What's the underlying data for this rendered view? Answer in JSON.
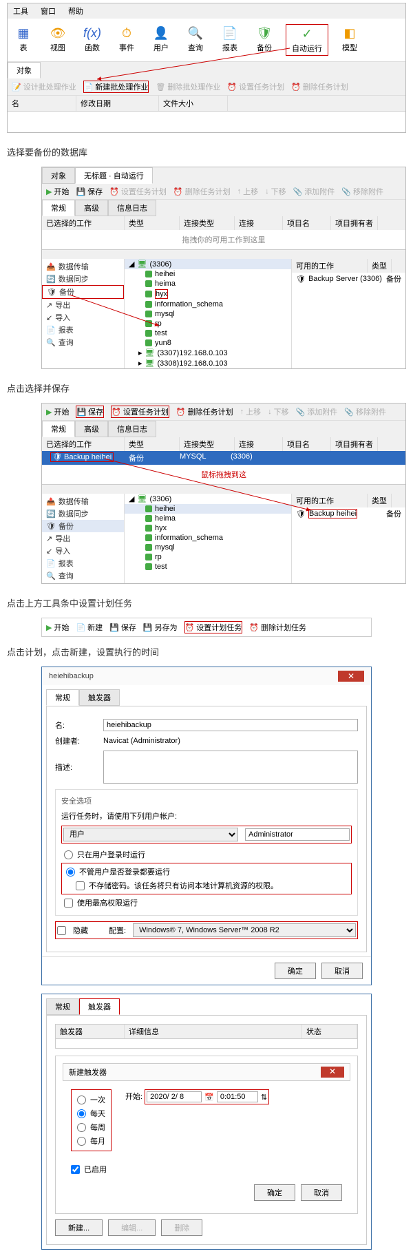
{
  "menu": {
    "tools": "工具",
    "window": "窗口",
    "help": "帮助"
  },
  "ribbon": {
    "table": "表",
    "view": "视图",
    "fx": "函数",
    "event": "事件",
    "user": "用户",
    "query": "查询",
    "report": "报表",
    "backup": "备份",
    "auto": "自动运行",
    "model": "模型"
  },
  "tabObject": "对象",
  "batchBar": {
    "design": "设计批处理作业",
    "new": "新建批处理作业",
    "delete": "删除批处理作业",
    "setPlan": "设置任务计划",
    "delPlan": "删除任务计划"
  },
  "cols1": {
    "name": "名",
    "modDate": "修改日期",
    "fileSize": "文件大小"
  },
  "step1": "选择要备份的数据库",
  "tabUntitled": "无标题 · 自动运行",
  "autoBar": {
    "start": "开始",
    "save": "保存",
    "setTask": "设置任务计划",
    "delTask": "删除任务计划",
    "up": "上移",
    "down": "下移",
    "addAttach": "添加附件",
    "delAttach": "移除附件"
  },
  "subTabs": {
    "general": "常规",
    "advanced": "高级",
    "log": "信息日志"
  },
  "workCols": {
    "selected": "已选择的工作",
    "type": "类型",
    "connType": "连接类型",
    "conn": "连接",
    "project": "项目名",
    "owner": "项目拥有者"
  },
  "dragHint": "拖拽你的可用工作到这里",
  "leftActions": {
    "transfer": "数据传输",
    "sync": "数据同步",
    "backup": "备份",
    "export": "导出",
    "import": "导入",
    "report": "报表",
    "query": "查询"
  },
  "dbRoot": "(3306)",
  "dbs": [
    "heihei",
    "heima",
    "hyx",
    "information_schema",
    "mysql",
    "rp",
    "test",
    "yun8"
  ],
  "dbExtra": [
    "(3307)192.168.0.103",
    "(3308)192.168.0.103"
  ],
  "availableCols": {
    "work": "可用的工作",
    "type": "类型"
  },
  "backupServer": "Backup Server (3306)",
  "backupType": "备份",
  "step2": "点击选择并保存",
  "selectedRow": {
    "name": "Backup heihei",
    "type": "备份",
    "connType": "MYSQL",
    "conn": "(3306)"
  },
  "dragMouseHint": "鼠标拖拽到这",
  "backupHeihei": "Backup heihei",
  "step3": "点击上方工具条中设置计划任务",
  "miniBar": {
    "start": "开始",
    "new": "新建",
    "save": "保存",
    "saveAs": "另存为",
    "setPlan": "设置计划任务",
    "delPlan": "删除计划任务"
  },
  "step4": "点击计划，点击新建，设置执行的时间",
  "dialog": {
    "title": "heiehibackup",
    "tabGeneral": "常规",
    "tabTrigger": "触发器",
    "nameLabel": "名:",
    "nameValue": "heiehibackup",
    "creatorLabel": "创建者:",
    "creatorValue": "Navicat (Administrator)",
    "descLabel": "描述:",
    "secTitle": "安全选项",
    "runAsLabel": "运行任务时，请使用下列用户帐户:",
    "userLabel": "用户",
    "userValue": "Administrator",
    "opt1": "只在用户登录时运行",
    "opt2": "不管用户是否登录都要运行",
    "opt2sub": "不存储密码。该任务将只有访问本地计算机资源的权限。",
    "opt3": "使用最高权限运行",
    "hidden": "隐藏",
    "configLabel": "配置:",
    "configValue": "Windows® 7, Windows Server™ 2008 R2",
    "ok": "确定",
    "cancel": "取消"
  },
  "trigger": {
    "tabGeneral": "常规",
    "tabTrigger": "触发器",
    "colTrigger": "触发器",
    "colDetail": "详细信息",
    "colStatus": "状态",
    "newTrigger": "新建触发器",
    "once": "一次",
    "daily": "每天",
    "weekly": "每周",
    "monthly": "每月",
    "startLabel": "开始:",
    "date": "2020/ 2/ 8",
    "time": "0:01:50",
    "enabled": "已启用",
    "ok": "确定",
    "cancel": "取消",
    "newBtn": "新建...",
    "editBtn": "编辑...",
    "delBtn": "删除"
  }
}
